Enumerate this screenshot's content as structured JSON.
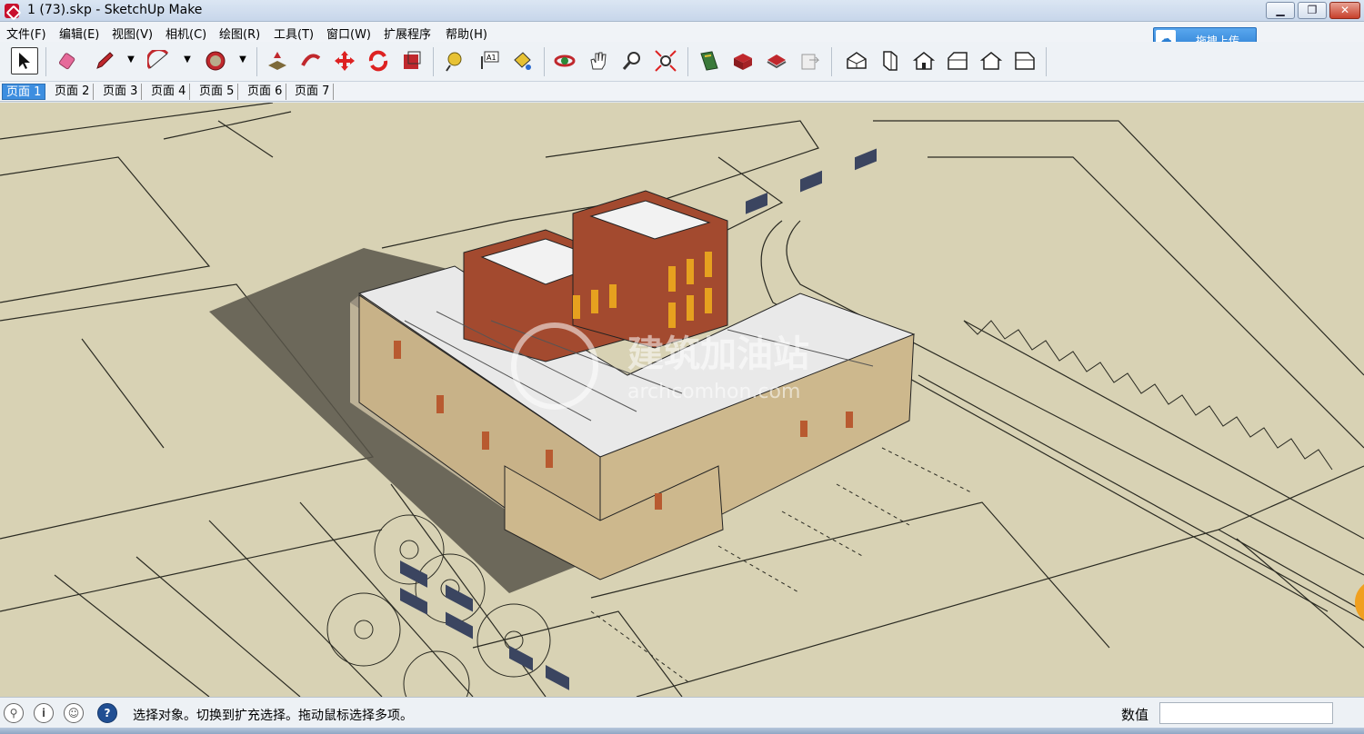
{
  "window": {
    "title": "1 (73).skp - SketchUp Make",
    "min_glyph": "▁",
    "max_glyph": "❐",
    "close_glyph": "✕"
  },
  "menu": [
    "文件(F)",
    "编辑(E)",
    "视图(V)",
    "相机(C)",
    "绘图(R)",
    "工具(T)",
    "窗口(W)",
    "扩展程序",
    "帮助(H)"
  ],
  "upload": {
    "label": "拖拽上传",
    "icon": "cloud-upload-icon"
  },
  "toolbar": [
    "select-arrow",
    "eraser",
    "pencil-line",
    "arc",
    "polygon-circle",
    "push-pull",
    "follow-me",
    "move",
    "rotate",
    "scale",
    "tape-measure",
    "text-label",
    "paint-bucket",
    "orbit",
    "pan",
    "zoom",
    "zoom-extents",
    "3d-warehouse",
    "extension-warehouse",
    "layout",
    "send-to-layout",
    "iso-view",
    "top-view",
    "front-view",
    "right-view",
    "back-view",
    "left-view"
  ],
  "tabs": [
    "页面 1",
    "页面 2",
    "页面 3",
    "页面 4",
    "页面 5",
    "页面 6",
    "页面 7"
  ],
  "watermark": {
    "cn": "建筑加油站",
    "en": "archcomhon.com"
  },
  "status": {
    "message": "选择对象。切换到扩充选择。拖动鼠标选择多项。",
    "value_label": "数值",
    "value": ""
  },
  "colors": {
    "ground": "#d8d2b4",
    "brick": "#a34a2f",
    "stone": "#cdb88d",
    "roof": "#ececec",
    "accent_tab": "#3d8ee0"
  }
}
